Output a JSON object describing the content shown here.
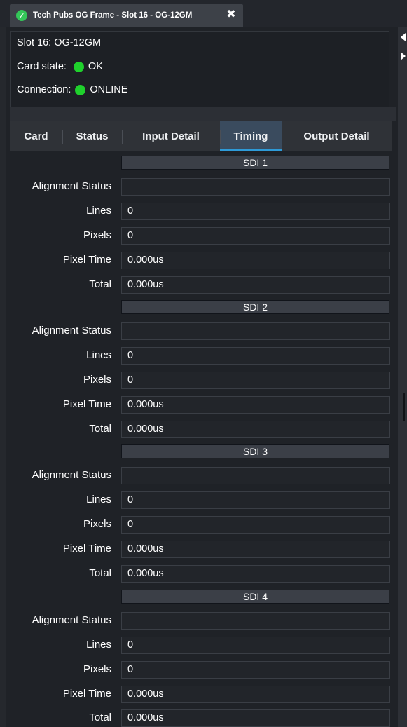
{
  "window": {
    "tab_title": "Tech Pubs OG Frame - Slot 16 - OG-12GM",
    "close_glyph": "✖",
    "ok_glyph": "✓"
  },
  "info": {
    "slot_label": "Slot 16: OG-12GM",
    "card_state_label": "Card state:",
    "card_state_value": "OK",
    "connection_label": "Connection:",
    "connection_value": "ONLINE",
    "status_color": "#1fd12c"
  },
  "tabs": [
    {
      "label": "Card",
      "active": false
    },
    {
      "label": "Status",
      "active": false
    },
    {
      "label": "Input Detail",
      "active": false
    },
    {
      "label": "Timing",
      "active": true
    },
    {
      "label": "Output Detail",
      "active": false
    }
  ],
  "sections": [
    {
      "title": "SDI 1",
      "rows": [
        {
          "label": "Alignment Status",
          "value": ""
        },
        {
          "label": "Lines",
          "value": "0"
        },
        {
          "label": "Pixels",
          "value": "0"
        },
        {
          "label": "Pixel Time",
          "value": "0.000us"
        },
        {
          "label": "Total",
          "value": "0.000us"
        }
      ]
    },
    {
      "title": "SDI 2",
      "rows": [
        {
          "label": "Alignment Status",
          "value": ""
        },
        {
          "label": "Lines",
          "value": "0"
        },
        {
          "label": "Pixels",
          "value": "0"
        },
        {
          "label": "Pixel Time",
          "value": "0.000us"
        },
        {
          "label": "Total",
          "value": "0.000us"
        }
      ]
    },
    {
      "title": "SDI 3",
      "rows": [
        {
          "label": "Alignment Status",
          "value": ""
        },
        {
          "label": "Lines",
          "value": "0"
        },
        {
          "label": "Pixels",
          "value": "0"
        },
        {
          "label": "Pixel Time",
          "value": "0.000us"
        },
        {
          "label": "Total",
          "value": "0.000us"
        }
      ]
    },
    {
      "title": "SDI 4",
      "rows": [
        {
          "label": "Alignment Status",
          "value": ""
        },
        {
          "label": "Lines",
          "value": "0"
        },
        {
          "label": "Pixels",
          "value": "0"
        },
        {
          "label": "Pixel Time",
          "value": "0.000us"
        },
        {
          "label": "Total",
          "value": "0.000us"
        }
      ]
    }
  ]
}
